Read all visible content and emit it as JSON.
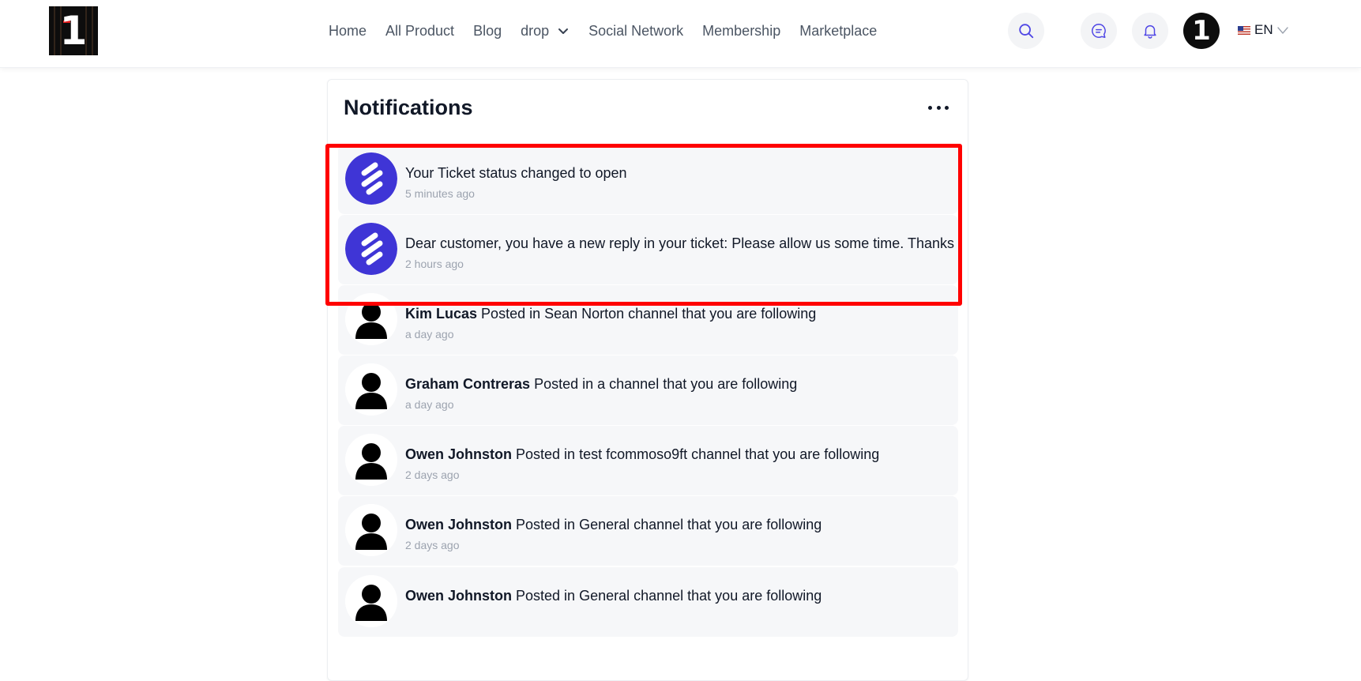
{
  "brand": {
    "logo_text": "1"
  },
  "nav": {
    "items": [
      "Home",
      "All Product",
      "Blog",
      "drop",
      "Social Network",
      "Membership",
      "Marketplace"
    ]
  },
  "header": {
    "avatar_text": "1",
    "language": "EN"
  },
  "notifications": {
    "title": "Notifications",
    "items": [
      {
        "actor": "",
        "message": "Your Ticket status changed to open",
        "time": "5 minutes ago",
        "avatar": "brand-logo-icon"
      },
      {
        "actor": "",
        "message": "Dear customer, you have a new reply in your ticket: Please allow us some time. Thanks",
        "time": "2 hours ago",
        "avatar": "brand-logo-icon"
      },
      {
        "actor": "Kim Lucas",
        "message": "Posted in Sean Norton channel that you are following",
        "time": "a day ago",
        "avatar": "user-icon"
      },
      {
        "actor": "Graham Contreras",
        "message": "Posted in a channel that you are following",
        "time": "a day ago",
        "avatar": "user-icon"
      },
      {
        "actor": "Owen Johnston",
        "message": "Posted in test fcommoso9ft channel that you are following",
        "time": "2 days ago",
        "avatar": "user-icon"
      },
      {
        "actor": "Owen Johnston",
        "message": "Posted in General channel that you are following",
        "time": "2 days ago",
        "avatar": "user-icon"
      },
      {
        "actor": "Owen Johnston",
        "message": "Posted in General channel that you are following",
        "time": "",
        "avatar": "user-icon"
      }
    ]
  },
  "colors": {
    "brand_purple": "#3f35d6",
    "highlight_red": "#ff0000",
    "muted_text": "#9ca3af",
    "row_bg": "#f6f7f9"
  }
}
